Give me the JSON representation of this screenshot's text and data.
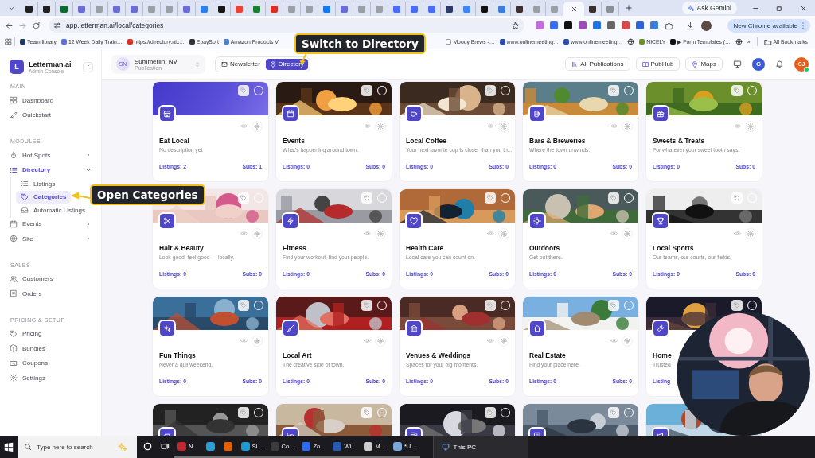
{
  "browser": {
    "tabs": [
      {
        "selected": false,
        "color": "#1f1f1f"
      },
      {
        "selected": false,
        "color": "#1f1f1f"
      },
      {
        "selected": false,
        "color": "#0b6b2e"
      },
      {
        "selected": false,
        "color": "#6b6fd4"
      },
      {
        "selected": false,
        "color": "#9aa0a6"
      },
      {
        "selected": false,
        "color": "#6b6fd4"
      },
      {
        "selected": false,
        "color": "#6b6fd4"
      },
      {
        "selected": false,
        "color": "#9aa0a6"
      },
      {
        "selected": false,
        "color": "#9aa0a6"
      },
      {
        "selected": false,
        "color": "#6b6fd4"
      },
      {
        "selected": false,
        "color": "#2f80ed"
      },
      {
        "selected": false,
        "color": "#161616"
      },
      {
        "selected": false,
        "color": "#ea4335"
      },
      {
        "selected": false,
        "color": "#1e7e34"
      },
      {
        "selected": false,
        "color": "#d93025"
      },
      {
        "selected": false,
        "color": "#9aa0a6"
      },
      {
        "selected": false,
        "color": "#9aa0a6"
      },
      {
        "selected": false,
        "color": "#1877f2"
      },
      {
        "selected": false,
        "color": "#6b6fd4"
      },
      {
        "selected": false,
        "color": "#9aa0a6"
      },
      {
        "selected": false,
        "color": "#9aa0a6"
      },
      {
        "selected": false,
        "color": "#4a6cf7"
      },
      {
        "selected": false,
        "color": "#4a6cf7"
      },
      {
        "selected": false,
        "color": "#4a6cf7"
      },
      {
        "selected": false,
        "color": "#2b3a67"
      },
      {
        "selected": false,
        "color": "#4285f4"
      },
      {
        "selected": false,
        "color": "#111111"
      },
      {
        "selected": false,
        "color": "#3b7dd8"
      },
      {
        "selected": false,
        "color": "#3a2e2e"
      },
      {
        "selected": false,
        "color": "#9aa0a6"
      },
      {
        "selected": false,
        "color": "#9aa0a6"
      },
      {
        "selected": true
      },
      {
        "selected": false,
        "color": "#3a2e2e"
      },
      {
        "selected": false,
        "color": "#8a8f98"
      }
    ],
    "gemini": "Ask Gemini",
    "url": "app.letterman.ai/local/categories",
    "update": "New Chrome available",
    "bookmarks_left": [
      {
        "kind": "link",
        "label": "Team library",
        "color": "#1b3a5c"
      },
      {
        "kind": "link",
        "label": "12 Week Daily Train…",
        "color": "#5b6ee1"
      },
      {
        "kind": "link",
        "label": "https://directory.nic…",
        "color": "#d93025"
      },
      {
        "kind": "link",
        "label": "EbaySort",
        "color": "#333333"
      },
      {
        "kind": "link",
        "label": "Amazon Products Vi",
        "color": "#4a7fd8"
      }
    ],
    "bookmarks_right": [
      {
        "kind": "link",
        "label": "Moody Brews -…",
        "color": "#ffffff"
      },
      {
        "kind": "link",
        "label": "www.onlinemeeting…",
        "color": "#2d4aa8"
      },
      {
        "kind": "link",
        "label": "www.onlinemeeting…",
        "color": "#2d4aa8"
      },
      {
        "kind": "icon"
      },
      {
        "kind": "link",
        "label": "NICELY",
        "color": "#6b8e23"
      },
      {
        "kind": "link",
        "label": "▶ Form Templates (…",
        "color": "#111111"
      },
      {
        "kind": "icon"
      }
    ],
    "more": "»",
    "all_bookmarks": "All Bookmarks"
  },
  "sidebar": {
    "logo": "L",
    "name": "Letterman.ai",
    "subtitle": "Admin Console",
    "sections": [
      {
        "title": "MAIN",
        "items": [
          {
            "label": "Dashboard",
            "selected": false
          },
          {
            "label": "Quickstart",
            "selected": false
          }
        ]
      },
      {
        "title": "MODULES",
        "items": [
          {
            "label": "Hot Spots",
            "selected": false,
            "expanded": false
          },
          {
            "label": "Directory",
            "selected": false,
            "expanded": true,
            "children": [
              {
                "label": "Listings",
                "selected": false
              },
              {
                "label": "Categories",
                "selected": true
              },
              {
                "label": "Automatic Listings",
                "selected": false
              }
            ]
          },
          {
            "label": "Events",
            "selected": false,
            "expanded": false
          },
          {
            "label": "Site",
            "selected": false,
            "expanded": false
          }
        ]
      },
      {
        "title": "SALES",
        "items": [
          {
            "label": "Customers",
            "selected": false
          },
          {
            "label": "Orders",
            "selected": false
          }
        ]
      },
      {
        "title": "PRICING & SETUP",
        "items": [
          {
            "label": "Pricing",
            "selected": false
          },
          {
            "label": "Bundles",
            "selected": false
          },
          {
            "label": "Coupons",
            "selected": false
          },
          {
            "label": "Settings",
            "selected": false
          }
        ]
      }
    ]
  },
  "topbar": {
    "publication": {
      "initials": "SN",
      "name": "Summerlin, NV",
      "subtitle": "Publication"
    },
    "modes": [
      {
        "label": "Newsletter",
        "selected": false
      },
      {
        "label": "Directory",
        "selected": true
      }
    ],
    "buttons": [
      {
        "label": "All Publications"
      },
      {
        "label": "PubHub"
      },
      {
        "label": "Maps"
      }
    ],
    "account": "G",
    "user": "CJ"
  },
  "cards": [
    {
      "kind": "category",
      "title": "Eat Local",
      "description": "No description yet",
      "listings": "Listings: 2",
      "subs": "Subs: 1"
    },
    {
      "kind": "category",
      "title": "Events",
      "description": "What's happening around town.",
      "listings": "Listings: 0",
      "subs": "Subs: 0"
    },
    {
      "kind": "category",
      "title": "Local Coffee",
      "description": "Your next favorite cup is closer than you th...",
      "listings": "Listings: 0",
      "subs": "Subs: 0"
    },
    {
      "kind": "category",
      "title": "Bars & Breweries",
      "description": "Where the town unwinds.",
      "listings": "Listings: 0",
      "subs": "Subs: 0"
    },
    {
      "kind": "category",
      "title": "Sweets & Treats",
      "description": "For whatever your sweet tooth says.",
      "listings": "Listings: 0",
      "subs": "Subs: 0"
    },
    {
      "kind": "category",
      "title": "Hair & Beauty",
      "description": "Look good, feel good — locally.",
      "listings": "Listings: 0",
      "subs": "Subs: 0"
    },
    {
      "kind": "category",
      "title": "Fitness",
      "description": "Find your workout, find your people.",
      "listings": "Listings: 0",
      "subs": "Subs: 0"
    },
    {
      "kind": "category",
      "title": "Health Care",
      "description": "Local care you can count on.",
      "listings": "Listings: 0",
      "subs": "Subs: 0"
    },
    {
      "kind": "category",
      "title": "Outdoors",
      "description": "Get out there.",
      "listings": "Listings: 0",
      "subs": "Subs: 0"
    },
    {
      "kind": "category",
      "title": "Local Sports",
      "description": "Our teams, our courts, our fields.",
      "listings": "Listings: 0",
      "subs": "Subs: 0"
    },
    {
      "kind": "category",
      "title": "Fun Things",
      "description": "Never a dull weekend.",
      "listings": "Listings: 0",
      "subs": "Subs: 0"
    },
    {
      "kind": "category",
      "title": "Local Art",
      "description": "The creative side of town.",
      "listings": "Listings: 0",
      "subs": "Subs: 0"
    },
    {
      "kind": "category",
      "title": "Venues & Weddings",
      "description": "Spaces for your big moments.",
      "listings": "Listings: 0",
      "subs": "Subs: 0"
    },
    {
      "kind": "category",
      "title": "Real Estate",
      "description": "Find your place here.",
      "listings": "Listings: 0",
      "subs": "Subs: 0"
    },
    {
      "kind": "category",
      "title": "Home",
      "description": "Trusted",
      "listings": "Listing"
    },
    {
      "kind": "picture"
    },
    {
      "kind": "picture"
    },
    {
      "kind": "picture"
    },
    {
      "kind": "picture"
    },
    {
      "kind": "picture"
    }
  ],
  "callouts": [
    {
      "text": "Switch to Directory"
    },
    {
      "text": "Open Categories"
    }
  ],
  "taskbar": {
    "search": "Type here to search",
    "apps": [
      {
        "kind": "circle"
      },
      {
        "kind": "taskview"
      },
      {
        "kind": "app",
        "label": "N...",
        "color": "#c0282d"
      },
      {
        "kind": "app",
        "color": "#2a9fd6"
      },
      {
        "kind": "app",
        "color": "#e66000"
      },
      {
        "kind": "app",
        "label": "Si...",
        "color": "#1d9bd1"
      },
      {
        "kind": "app",
        "label": "Co...",
        "color": "#3c3c3c"
      },
      {
        "kind": "app",
        "label": "Zo...",
        "color": "#2d6cf0"
      },
      {
        "kind": "app",
        "label": "Wi...",
        "color": "#2a5bb0"
      },
      {
        "kind": "app",
        "label": "M...",
        "color": "#cccccc"
      },
      {
        "kind": "app",
        "label": "*U...",
        "color": "#7aa7d8"
      }
    ],
    "tile": "This PC"
  }
}
